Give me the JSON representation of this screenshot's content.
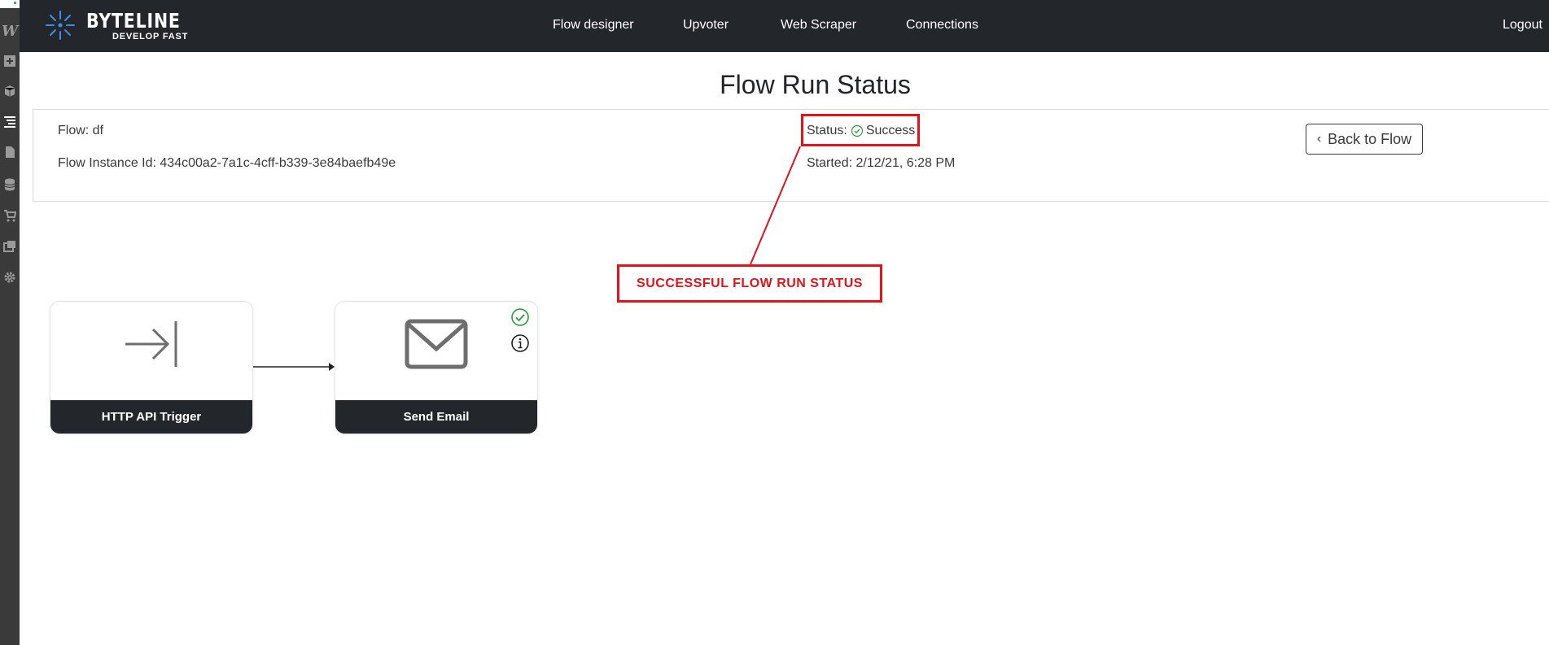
{
  "navbar": {
    "brand_name": "BYTELINE",
    "brand_tagline": "DEVELOP FAST",
    "links": [
      "Flow designer",
      "Upvoter",
      "Web Scraper",
      "Connections"
    ],
    "logout": "Logout"
  },
  "page": {
    "title": "Flow Run Status"
  },
  "run_info": {
    "flow": "Flow: df",
    "instance_id": "Flow Instance Id: 434c00a2-7a1c-4cff-b339-3e84baefb49e",
    "status_label": "Status:",
    "status_value": "Success",
    "started": "Started: 2/12/21, 6:28 PM",
    "back_button": "Back to Flow"
  },
  "annotation": {
    "text": "SUCCESSFUL FLOW RUN STATUS",
    "color": "#e4121b"
  },
  "flow_nodes": [
    {
      "label": "HTTP API Trigger",
      "icon": "arrow-to-bar-icon"
    },
    {
      "label": "Send Email",
      "icon": "envelope-icon",
      "status_icons": [
        "success-check-icon",
        "info-icon"
      ]
    }
  ],
  "colors": {
    "navbar": "#23272b",
    "success": "#2e9a3a",
    "annotation": "#e4121b"
  }
}
